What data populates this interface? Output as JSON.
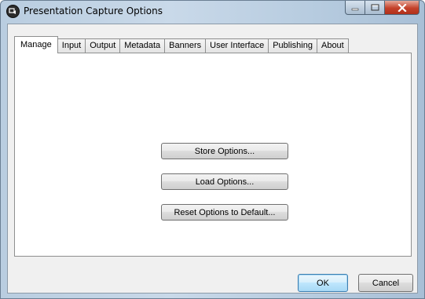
{
  "window": {
    "title": "Presentation Capture Options",
    "icon": "app-logo-icon"
  },
  "caption_buttons": {
    "minimize_icon": "minimize-icon",
    "maximize_icon": "maximize-icon",
    "close_icon": "close-icon"
  },
  "tabs": [
    {
      "label": "Manage",
      "active": true
    },
    {
      "label": "Input",
      "active": false
    },
    {
      "label": "Output",
      "active": false
    },
    {
      "label": "Metadata",
      "active": false
    },
    {
      "label": "Banners",
      "active": false
    },
    {
      "label": "User Interface",
      "active": false
    },
    {
      "label": "Publishing",
      "active": false
    },
    {
      "label": "About",
      "active": false
    }
  ],
  "manage_panel": {
    "store_label": "Store Options...",
    "load_label": "Load Options...",
    "reset_label": "Reset Options to Default..."
  },
  "dialog_buttons": {
    "ok_label": "OK",
    "cancel_label": "Cancel"
  },
  "colors": {
    "title_bar": "#c9d9e9",
    "client_background": "#f0f0f0",
    "close_button": "#c4412a",
    "default_button_border": "#3c7fb1"
  }
}
